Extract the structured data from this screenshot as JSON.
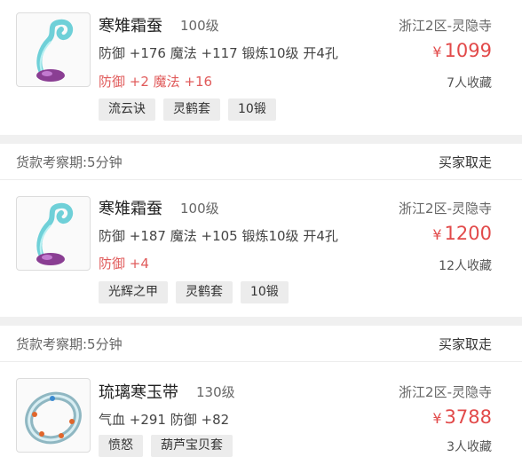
{
  "items": [
    {
      "name": "寒雉霜蚕",
      "level": "100级",
      "region": "浙江2区-灵隐寺",
      "stats": "防御 +176 魔法 +117 锻炼10级 开4孔",
      "extra": "防御 +2 魔法 +16",
      "currency": "¥",
      "price": "1099",
      "favorites": "7人收藏",
      "tags": [
        "流云诀",
        "灵鹤套",
        "10锻"
      ],
      "icon": "silkworm-icon"
    },
    {
      "name": "寒雉霜蚕",
      "level": "100级",
      "region": "浙江2区-灵隐寺",
      "stats": "防御 +187 魔法 +105 锻炼10级 开4孔",
      "extra": "防御 +4",
      "currency": "¥",
      "price": "1200",
      "favorites": "12人收藏",
      "tags": [
        "光辉之甲",
        "灵鹤套",
        "10锻"
      ],
      "icon": "silkworm-icon"
    },
    {
      "name": "琉璃寒玉带",
      "level": "130级",
      "region": "浙江2区-灵隐寺",
      "stats": "气血 +291 防御 +82",
      "extra": "",
      "currency": "¥",
      "price": "3788",
      "favorites": "3人收藏",
      "tags": [
        "愤怒",
        "葫芦宝贝套"
      ],
      "icon": "jade-belt-icon"
    }
  ],
  "meta_rows": [
    {
      "left": "货款考察期:5分钟",
      "right": "买家取走"
    },
    {
      "left": "货款考察期:5分钟",
      "right": "买家取走"
    }
  ],
  "colors": {
    "price": "#e24a4a",
    "extra": "#e05a5a",
    "tag_bg": "#ececec",
    "divider": "#f0f0f0"
  }
}
